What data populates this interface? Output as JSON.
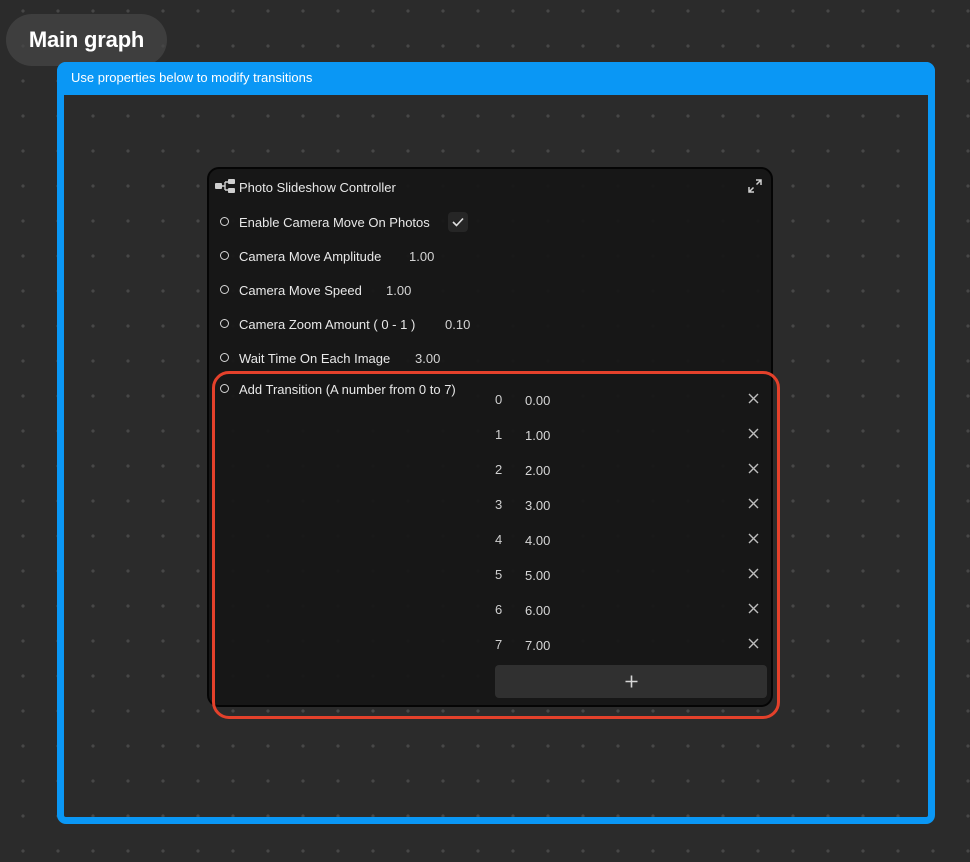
{
  "canvas": {
    "graph_name": "Main graph"
  },
  "group": {
    "comment": "Use properties below to modify transitions",
    "color": "#0a97f5"
  },
  "node": {
    "icon": "node-graph-icon",
    "title": "Photo Slideshow Controller",
    "expand_icon": "expand-icon",
    "properties": [
      {
        "label": "Enable Camera Move On Photos",
        "type": "checkbox",
        "checked": true,
        "icon": "checkmark-icon"
      },
      {
        "label": "Camera Move Amplitude",
        "type": "number",
        "value": "1.00"
      },
      {
        "label": "Camera Move Speed",
        "type": "number",
        "value": "1.00"
      },
      {
        "label": "Camera Zoom Amount ( 0 - 1 )",
        "type": "number",
        "value": "0.10"
      },
      {
        "label": "Wait Time On Each Image",
        "type": "number",
        "value": "3.00"
      },
      {
        "label": "Add Transition (A number from 0 to 7)",
        "type": "list"
      }
    ],
    "transitions": [
      {
        "index": "0",
        "value": "0.00"
      },
      {
        "index": "1",
        "value": "1.00"
      },
      {
        "index": "2",
        "value": "2.00"
      },
      {
        "index": "3",
        "value": "3.00"
      },
      {
        "index": "4",
        "value": "4.00"
      },
      {
        "index": "5",
        "value": "5.00"
      },
      {
        "index": "6",
        "value": "6.00"
      },
      {
        "index": "7",
        "value": "7.00"
      }
    ],
    "add_button_icon": "plus-icon",
    "remove_icon": "close-icon"
  },
  "annotation": {
    "highlight_color": "#e4412b"
  }
}
